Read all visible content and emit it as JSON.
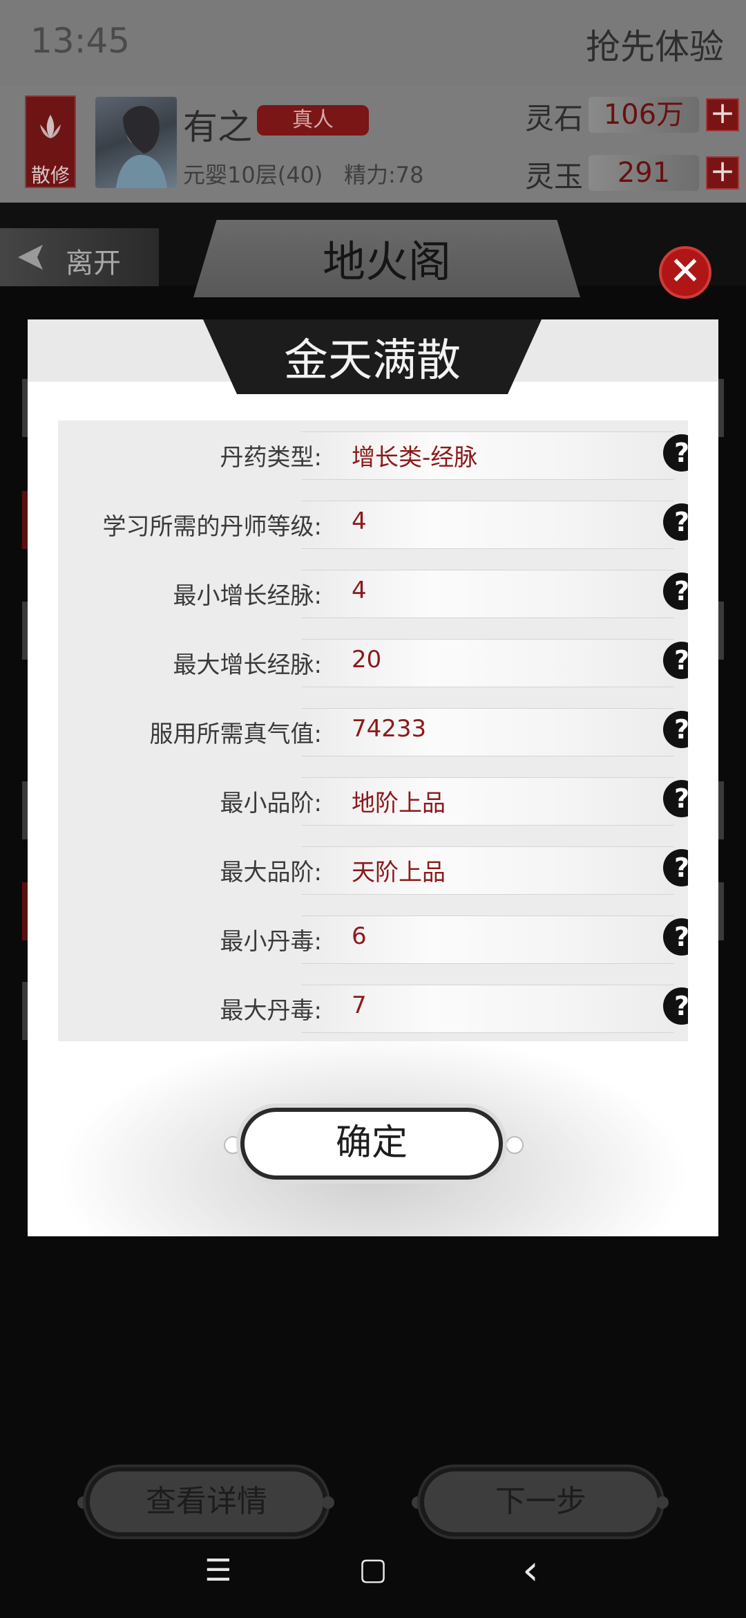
{
  "status": {
    "time": "13:45",
    "promo": "抢先体验"
  },
  "profile": {
    "sect": "散修",
    "name": "有之",
    "tag": "真人",
    "realm": "元婴10层(40)",
    "energy": "精力:78"
  },
  "currencies": [
    {
      "label": "灵石",
      "value": "106万"
    },
    {
      "label": "灵玉",
      "value": "291"
    }
  ],
  "titlebar": {
    "leave": "离开",
    "title": "地火阁"
  },
  "dialog": {
    "title": "金天满散",
    "rows": [
      {
        "label": "丹药类型:",
        "value": "增长类-经脉"
      },
      {
        "label": "学习所需的丹师等级:",
        "value": "4"
      },
      {
        "label": "最小增长经脉:",
        "value": "4"
      },
      {
        "label": "最大增长经脉:",
        "value": "20"
      },
      {
        "label": "服用所需真气值:",
        "value": "74233"
      },
      {
        "label": "最小品阶:",
        "value": "地阶上品"
      },
      {
        "label": "最大品阶:",
        "value": "天阶上品"
      },
      {
        "label": "最小丹毒:",
        "value": "6"
      },
      {
        "label": "最大丹毒:",
        "value": "7"
      }
    ],
    "help_glyph": "?",
    "confirm": "确定"
  },
  "bottom": {
    "details": "查看详情",
    "next": "下一步"
  },
  "icons": {
    "close": "✕",
    "plus": "+",
    "nav_menu": "☰",
    "nav_home": "▢",
    "nav_back": "‹"
  }
}
